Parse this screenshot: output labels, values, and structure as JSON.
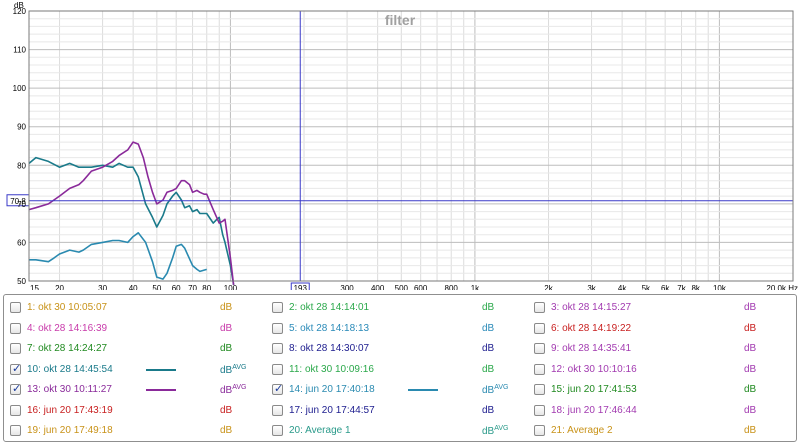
{
  "chart_data": {
    "type": "line",
    "title": "filter",
    "ylabel": "dB",
    "xunit": "Hz",
    "xscale": "log",
    "xlim": [
      15,
      20000
    ],
    "ylim": [
      50,
      120
    ],
    "grid": true,
    "y_ticks": [
      "50",
      "60",
      "70",
      "80",
      "90",
      "100",
      "110",
      "120"
    ],
    "x_ticks": [
      {
        "f": 15,
        "label": "15"
      },
      {
        "f": 20,
        "label": "20"
      },
      {
        "f": 30,
        "label": "30"
      },
      {
        "f": 40,
        "label": "40"
      },
      {
        "f": 50,
        "label": "50"
      },
      {
        "f": 60,
        "label": "60"
      },
      {
        "f": 70,
        "label": "70"
      },
      {
        "f": 80,
        "label": "80"
      },
      {
        "f": 100,
        "label": "100"
      },
      {
        "f": 300,
        "label": "300"
      },
      {
        "f": 400,
        "label": "400"
      },
      {
        "f": 500,
        "label": "500"
      },
      {
        "f": 600,
        "label": "600"
      },
      {
        "f": 800,
        "label": "800"
      },
      {
        "f": 1000,
        "label": "1k"
      },
      {
        "f": 2000,
        "label": "2k"
      },
      {
        "f": 3000,
        "label": "3k"
      },
      {
        "f": 4000,
        "label": "4k"
      },
      {
        "f": 5000,
        "label": "5k"
      },
      {
        "f": 6000,
        "label": "6k"
      },
      {
        "f": 7000,
        "label": "7k"
      },
      {
        "f": 8000,
        "label": "8k"
      },
      {
        "f": 10000,
        "label": "10k"
      },
      {
        "f": 20000,
        "label": "20,0k Hz"
      }
    ],
    "cursor": {
      "x": 193,
      "x_label": "193",
      "y": 70.8,
      "y_label": "70,8"
    },
    "series": [
      {
        "name": "10: okt 28 14:45:54",
        "color": "#1a7a8a",
        "x": [
          15,
          16,
          18,
          20,
          22,
          24,
          25,
          27,
          30,
          33,
          35,
          38,
          40,
          42,
          45,
          48,
          50,
          53,
          55,
          58,
          60,
          63,
          65,
          68,
          70,
          73,
          75,
          80,
          85,
          88,
          90,
          93,
          95,
          100,
          103
        ],
        "y": [
          80.5,
          82,
          81,
          79.5,
          80.5,
          79.5,
          79.5,
          79.5,
          80,
          79.5,
          80.5,
          79.5,
          79.5,
          77,
          70,
          66.5,
          64,
          67,
          70,
          72,
          73,
          71,
          69,
          69.5,
          68,
          68.5,
          67.5,
          67.5,
          65,
          66,
          66.5,
          62,
          60,
          54,
          49
        ]
      },
      {
        "name": "13: okt 30 10:11:27",
        "color": "#8a2a9a",
        "x": [
          15,
          16,
          18,
          20,
          22,
          24,
          25,
          27,
          30,
          33,
          35,
          38,
          40,
          42,
          44,
          46,
          48,
          50,
          53,
          55,
          58,
          60,
          63,
          65,
          68,
          70,
          73,
          75,
          78,
          80,
          85,
          90,
          93,
          95,
          100,
          103
        ],
        "y": [
          68.5,
          69,
          70,
          72,
          74,
          75,
          76,
          78.5,
          79.5,
          81,
          82.5,
          84,
          86,
          85.5,
          82,
          77,
          73,
          70,
          71,
          73,
          73.5,
          74,
          76,
          76,
          75,
          73,
          73.5,
          73,
          72.5,
          72.5,
          68.5,
          65,
          65.5,
          66,
          56,
          49
        ]
      },
      {
        "name": "14: jun 20 17:40:18",
        "color": "#2a8ab0",
        "x": [
          15,
          16,
          18,
          19,
          20,
          22,
          24,
          25,
          27,
          30,
          33,
          35,
          38,
          40,
          42,
          45,
          48,
          50,
          53,
          55,
          58,
          60,
          63,
          65,
          70,
          73,
          75,
          80
        ],
        "y": [
          55.5,
          55.5,
          55,
          56,
          57,
          58,
          57.5,
          58,
          59.5,
          60,
          60.5,
          60.5,
          60,
          61.5,
          62.5,
          60,
          55,
          51,
          50.5,
          52,
          56,
          59,
          59.5,
          58.5,
          54,
          53,
          52.5,
          53
        ]
      }
    ]
  },
  "legend": [
    {
      "label": "1: okt 30 10:05:07",
      "unit": "dB",
      "avg": "",
      "checked": false,
      "color": "#c89218",
      "swatch": false
    },
    {
      "label": "2: okt 28 14:14:01",
      "unit": "dB",
      "avg": "",
      "checked": false,
      "color": "#2aa84a",
      "swatch": false
    },
    {
      "label": "3: okt 28 14:15:27",
      "unit": "dB",
      "avg": "",
      "checked": false,
      "color": "#a23ab0",
      "swatch": false
    },
    {
      "label": "4: okt 28 14:16:39",
      "unit": "dB",
      "avg": "",
      "checked": false,
      "color": "#c83aaa",
      "swatch": false
    },
    {
      "label": "5: okt 28 14:18:13",
      "unit": "dB",
      "avg": "",
      "checked": false,
      "color": "#2a8ab8",
      "swatch": false
    },
    {
      "label": "6: okt 28 14:19:22",
      "unit": "dB",
      "avg": "",
      "checked": false,
      "color": "#c82020",
      "swatch": false
    },
    {
      "label": "7: okt 28 14:24:27",
      "unit": "dB",
      "avg": "",
      "checked": false,
      "color": "#208a20",
      "swatch": false
    },
    {
      "label": "8: okt 28 14:30:07",
      "unit": "dB",
      "avg": "",
      "checked": false,
      "color": "#202090",
      "swatch": false
    },
    {
      "label": "9: okt 28 14:35:41",
      "unit": "dB",
      "avg": "",
      "checked": false,
      "color": "#a23ab0",
      "swatch": false
    },
    {
      "label": "10: okt 28 14:45:54",
      "unit": "dB",
      "avg": "AVG",
      "checked": true,
      "color": "#1a7a8a",
      "swatch": true
    },
    {
      "label": "11: okt 30 10:09:16",
      "unit": "dB",
      "avg": "",
      "checked": false,
      "color": "#2aa84a",
      "swatch": false
    },
    {
      "label": "12: okt 30 10:10:16",
      "unit": "dB",
      "avg": "",
      "checked": false,
      "color": "#a23ab0",
      "swatch": false
    },
    {
      "label": "13: okt 30 10:11:27",
      "unit": "dB",
      "avg": "AVG",
      "checked": true,
      "color": "#8a2a9a",
      "swatch": true
    },
    {
      "label": "14: jun 20 17:40:18",
      "unit": "dB",
      "avg": "AVG",
      "checked": true,
      "color": "#2a8ab0",
      "swatch": true
    },
    {
      "label": "15: jun 20 17:41:53",
      "unit": "dB",
      "avg": "",
      "checked": false,
      "color": "#208a20",
      "swatch": false
    },
    {
      "label": "16: jun 20 17:43:19",
      "unit": "dB",
      "avg": "",
      "checked": false,
      "color": "#c82020",
      "swatch": false
    },
    {
      "label": "17: jun 20 17:44:57",
      "unit": "dB",
      "avg": "",
      "checked": false,
      "color": "#202090",
      "swatch": false
    },
    {
      "label": "18: jun 20 17:46:44",
      "unit": "dB",
      "avg": "",
      "checked": false,
      "color": "#a23ab0",
      "swatch": false
    },
    {
      "label": "19: jun 20 17:49:18",
      "unit": "dB",
      "avg": "",
      "checked": false,
      "color": "#c89218",
      "swatch": false
    },
    {
      "label": "20: Average 1",
      "unit": "dB",
      "avg": "AVG",
      "checked": false,
      "color": "#2a9a8a",
      "swatch": false
    },
    {
      "label": "21: Average 2",
      "unit": "dB",
      "avg": "",
      "checked": false,
      "color": "#c89218",
      "swatch": false
    }
  ]
}
